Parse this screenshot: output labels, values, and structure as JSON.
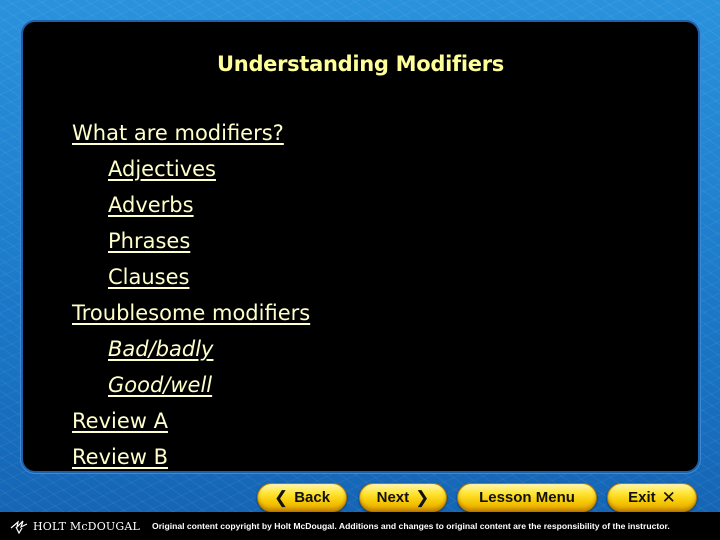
{
  "slide": {
    "title": "Understanding Modifiers",
    "menu": [
      {
        "label": "What are modifiers?",
        "level": 0,
        "italic": false
      },
      {
        "label": "Adjectives",
        "level": 1,
        "italic": false
      },
      {
        "label": "Adverbs",
        "level": 1,
        "italic": false
      },
      {
        "label": "Phrases",
        "level": 1,
        "italic": false
      },
      {
        "label": "Clauses",
        "level": 1,
        "italic": false
      },
      {
        "label": "Troublesome modifiers",
        "level": 0,
        "italic": false
      },
      {
        "label": "Bad/badly",
        "level": 1,
        "italic": true
      },
      {
        "label": "Good/well",
        "level": 1,
        "italic": true
      },
      {
        "label": "Review A",
        "level": 0,
        "italic": false
      },
      {
        "label": "Review B",
        "level": 0,
        "italic": false
      }
    ]
  },
  "nav": {
    "back": {
      "label": "Back",
      "icon": "chevron-left-icon",
      "glyph": "❮"
    },
    "next": {
      "label": "Next",
      "icon": "chevron-right-icon",
      "glyph": "❯"
    },
    "lesson_menu": {
      "label": "Lesson Menu"
    },
    "exit": {
      "label": "Exit",
      "icon": "close-icon",
      "glyph": "✕"
    }
  },
  "footer": {
    "brand": "HOLT McDOUGAL",
    "copyright": "Original content copyright by Holt McDougal. Additions and changes to original content are the responsibility of the instructor."
  },
  "colors": {
    "title": "#ffff99",
    "link": "#ffffcc",
    "panel": "#000000",
    "background": "#1f7fd0",
    "button": "#ffe433"
  }
}
